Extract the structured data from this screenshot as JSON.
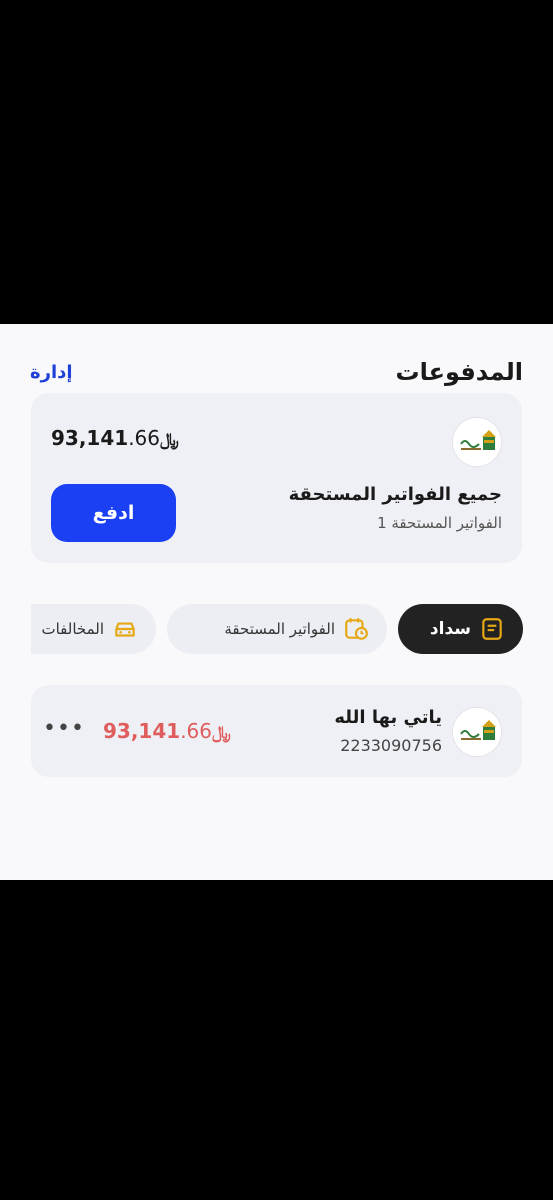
{
  "header": {
    "title": "المدفوعات",
    "manage_label": "إدارة"
  },
  "summary": {
    "amount_int": "93,141",
    "amount_dec": ".66",
    "currency": "﷼",
    "title": "جميع الفواتير المستحقة",
    "subtitle": "1 الفواتير المستحقة",
    "pay_label": "ادفع"
  },
  "tabs": [
    {
      "label": "سداد",
      "icon": "receipt-icon",
      "active": true
    },
    {
      "label": "الفواتير المستحقة",
      "icon": "calendar-clock-icon",
      "active": false
    },
    {
      "label": "المخالفات",
      "icon": "car-icon",
      "active": false
    }
  ],
  "bill": {
    "name": "ياتي بها الله",
    "id": "2233090756",
    "amount_int": "93,141",
    "amount_dec": ".66",
    "currency": "﷼",
    "more": "•••"
  },
  "colors": {
    "accent": "#1b3ff2",
    "link": "#1f3fd6",
    "amount_due": "#e05d5d",
    "tab_icon": "#e6a817"
  }
}
